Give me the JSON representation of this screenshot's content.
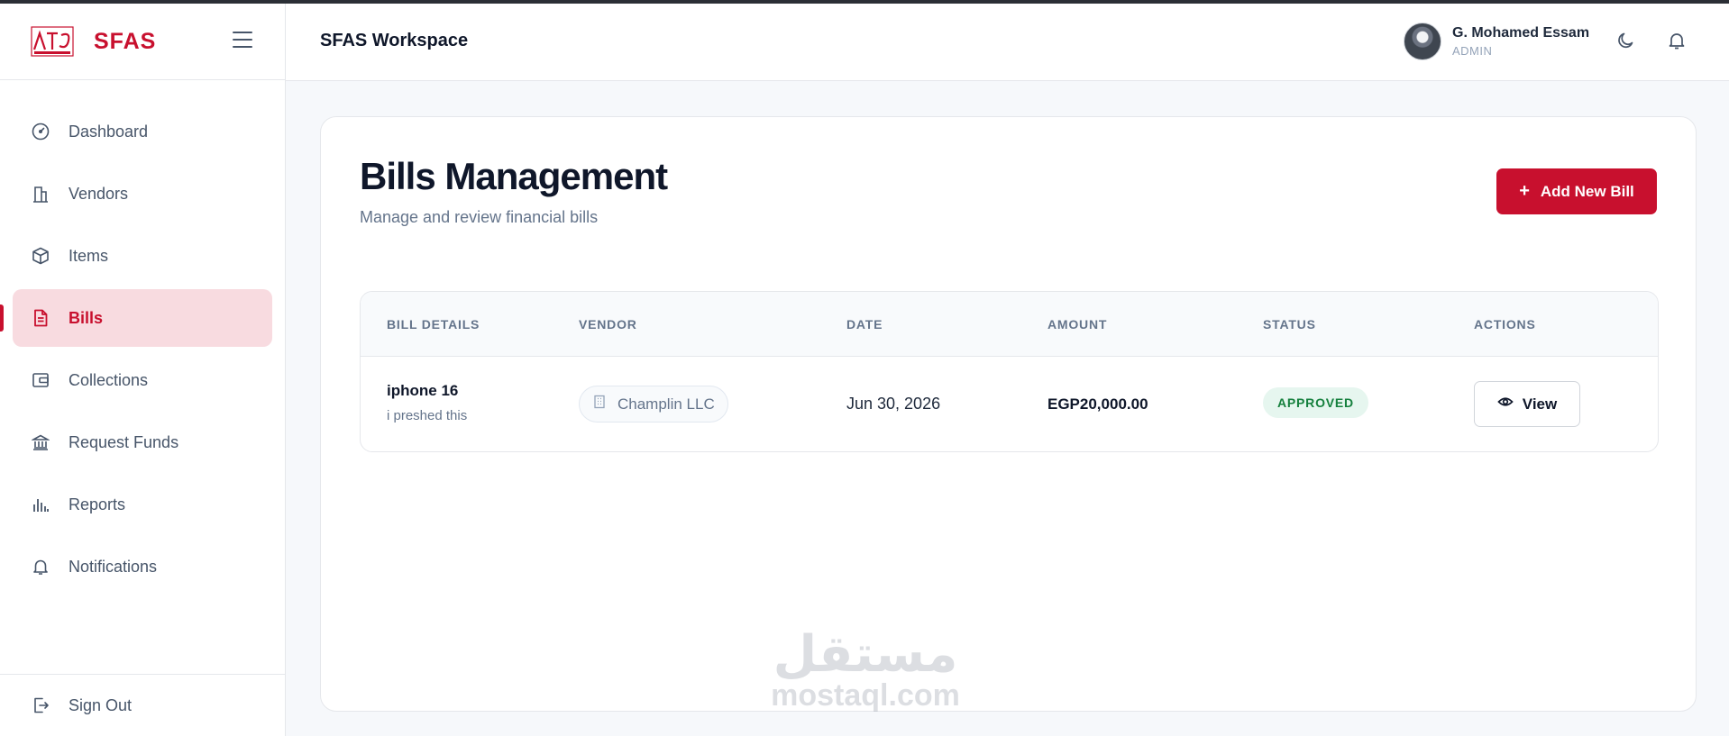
{
  "brand": {
    "name": "SFAS",
    "logo_label": "NTG"
  },
  "header": {
    "workspace_title": "SFAS Workspace",
    "user": {
      "name": "G. Mohamed Essam",
      "role": "ADMIN"
    }
  },
  "sidebar": {
    "items": [
      {
        "label": "Dashboard",
        "icon": "gauge-icon",
        "active": false
      },
      {
        "label": "Vendors",
        "icon": "building-icon",
        "active": false
      },
      {
        "label": "Items",
        "icon": "box-icon",
        "active": false
      },
      {
        "label": "Bills",
        "icon": "document-icon",
        "active": true
      },
      {
        "label": "Collections",
        "icon": "wallet-icon",
        "active": false
      },
      {
        "label": "Request Funds",
        "icon": "bank-icon",
        "active": false
      },
      {
        "label": "Reports",
        "icon": "bar-chart-icon",
        "active": false
      },
      {
        "label": "Notifications",
        "icon": "bell-icon",
        "active": false
      }
    ],
    "sign_out": "Sign Out"
  },
  "main": {
    "title": "Bills Management",
    "subtitle": "Manage and review financial bills",
    "add_button": "Add New Bill",
    "table": {
      "headers": [
        "BILL DETAILS",
        "VENDOR",
        "DATE",
        "AMOUNT",
        "STATUS",
        "ACTIONS"
      ],
      "rows": [
        {
          "title": "iphone 16",
          "description": "i preshed this",
          "vendor": "Champlin LLC",
          "date": "Jun 30, 2026",
          "amount": "EGP20,000.00",
          "status": "APPROVED",
          "action": "View"
        }
      ]
    }
  },
  "watermark": {
    "arabic": "مستقل",
    "latin": "mostaql.com"
  },
  "colors": {
    "brand": "#c8102e",
    "active_bg": "#f8dbe0",
    "approved_bg": "#e6f6ef",
    "approved_text": "#15803d"
  }
}
